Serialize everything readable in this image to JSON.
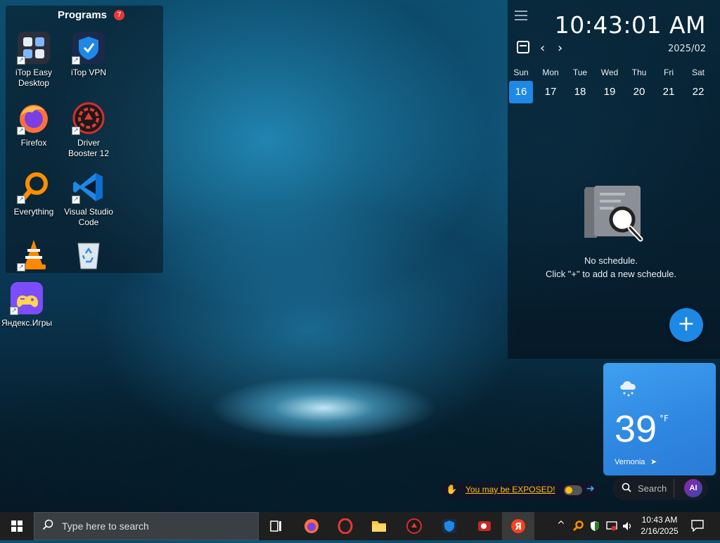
{
  "fence": {
    "title": "Programs",
    "badge": "7",
    "icons": [
      {
        "label": "iTop Easy Desktop",
        "icon": "itop-easy-desktop-icon"
      },
      {
        "label": "iTop VPN",
        "icon": "itop-vpn-icon"
      },
      {
        "label": "Firefox",
        "icon": "firefox-icon"
      },
      {
        "label": "Driver Booster 12",
        "icon": "driver-booster-icon"
      },
      {
        "label": "Everything",
        "icon": "everything-search-icon"
      },
      {
        "label": "Visual Studio Code",
        "icon": "vscode-icon"
      },
      {
        "label": "",
        "icon": "vlc-icon"
      },
      {
        "label": "",
        "icon": "recycle-bin-icon"
      }
    ]
  },
  "desktop": {
    "yandex_label": "Яндекс.Игры"
  },
  "calendar": {
    "time": "10:43:01 AM",
    "month": "2025/02",
    "weekdays": [
      "Sun",
      "Mon",
      "Tue",
      "Wed",
      "Thu",
      "Fri",
      "Sat"
    ],
    "days": [
      "16",
      "17",
      "18",
      "19",
      "20",
      "21",
      "22"
    ],
    "selected_day": "16",
    "empty_line1": "No schedule.",
    "empty_line2": "Click \"+\" to add a new schedule.",
    "add_label": "+"
  },
  "weather": {
    "temp": "39",
    "unit": "°F",
    "location": "Vernonia",
    "condition_icon": "cloud-snow-icon"
  },
  "exposed": {
    "text": "You may be EXPOSED!"
  },
  "widget_search": {
    "placeholder": "Search",
    "ai_label": "AI"
  },
  "taskbar": {
    "search_placeholder": "Type here to search",
    "apps": [
      "task-view-icon",
      "firefox-icon",
      "opera-icon",
      "file-explorer-icon",
      "driver-booster-icon",
      "itop-vpn-icon",
      "screen-recorder-icon",
      "yandex-browser-icon"
    ],
    "time": "10:43 AM",
    "date": "2/16/2025"
  },
  "colors": {
    "accent": "#1e88e5",
    "warning": "#ffc107",
    "weather_bg": "#2e86e0",
    "taskbar": "#1f1f1f"
  }
}
